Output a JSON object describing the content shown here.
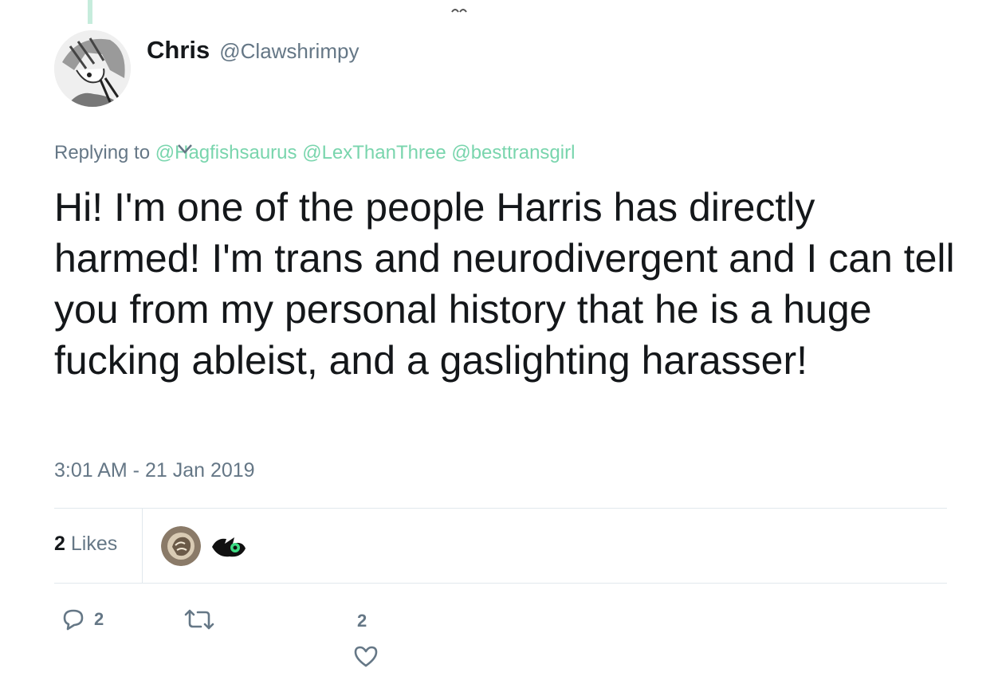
{
  "tweet": {
    "display_name": "Chris",
    "handle": "@Clawshrimpy",
    "replying_prefix": "Replying to",
    "reply_mentions": [
      "@Hagfishsaurus",
      "@LexThanThree",
      "@besttransgirl"
    ],
    "text": "Hi! I'm one of the people Harris has directly harmed! I'm trans and neurodivergent and I can tell you from my personal history that he is a huge fucking ableist, and a gaslighting harasser!",
    "timestamp": "3:01 AM - 21 Jan 2019"
  },
  "stats": {
    "likes_count": "2",
    "likes_label": "Likes"
  },
  "actions": {
    "reply_count": "2",
    "retweet_count": "",
    "like_count": "2"
  },
  "icons": {
    "reply": "reply-bubble-icon",
    "retweet": "retweet-icon",
    "like": "heart-icon",
    "caret": "chevron-down-icon"
  },
  "colors": {
    "mention": "#79d5ad",
    "muted": "#657786",
    "text": "#14171a",
    "divider": "#e1e8ed"
  }
}
